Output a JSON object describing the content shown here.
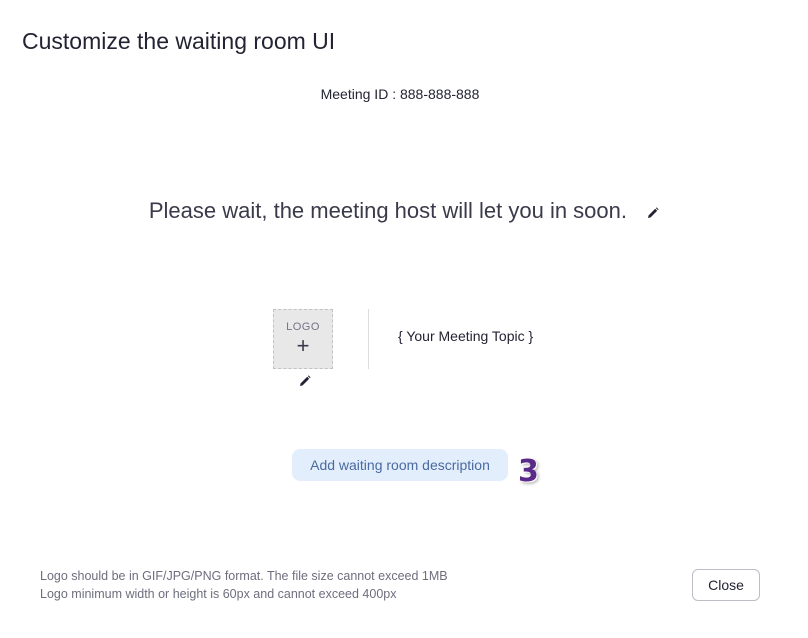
{
  "title": "Customize the waiting room UI",
  "meeting_id": "Meeting ID : 888-888-888",
  "wait_message": "Please wait, the meeting host will let you in soon.",
  "logo": {
    "label": "LOGO",
    "plus": "+"
  },
  "topic": "{ Your Meeting Topic }",
  "add_description_label": "Add waiting room description",
  "step_badge": "3",
  "hints": [
    "Logo should be in GIF/JPG/PNG format. The file size cannot exceed 1MB",
    "Logo minimum width or height is 60px and cannot exceed 400px"
  ],
  "close_label": "Close",
  "colors": {
    "step_badge": "#5a2a88",
    "add_button_bg": "#e3eefc",
    "add_button_text": "#4a6aa0"
  },
  "icons": {
    "edit_message": "pencil-icon",
    "edit_logo": "pencil-icon"
  }
}
